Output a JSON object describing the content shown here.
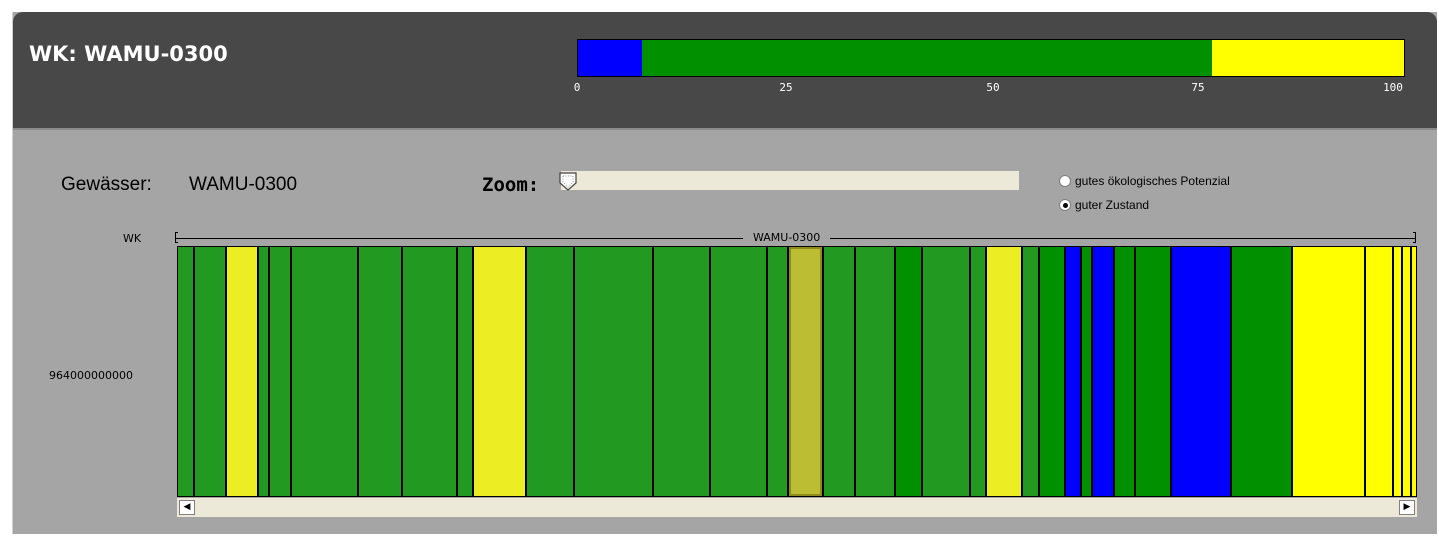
{
  "header": {
    "title": "WK: WAMU-0300",
    "summary": {
      "scale_ticks": [
        "0",
        "25",
        "50",
        "75",
        "100"
      ],
      "segments": [
        {
          "from": 0,
          "to": 7.8,
          "color": "#0000ff"
        },
        {
          "from": 7.8,
          "to": 76.8,
          "color": "#009000"
        },
        {
          "from": 76.8,
          "to": 100,
          "color": "#ffff00"
        }
      ]
    }
  },
  "info": {
    "gewaesser_label": "Gewässer:",
    "gewaesser_value": "WAMU-0300",
    "zoom_label": "Zoom:",
    "zoom_level": 0
  },
  "options": {
    "radio_potential": "gutes ökologisches Potenzial",
    "radio_zustand": "guter Zustand",
    "selected": "guter Zustand"
  },
  "track": {
    "wk_label": "WK",
    "wk_name": "WAMU-0300",
    "section_label": "964000000000"
  },
  "strip_segments": [
    {
      "color": "#229a22",
      "share": 1.32
    },
    {
      "color": "#229a22",
      "share": 2.57
    },
    {
      "color": "#eded24",
      "share": 2.57
    },
    {
      "color": "#229a22",
      "share": 0.88
    },
    {
      "color": "#229a22",
      "share": 1.69
    },
    {
      "color": "#229a22",
      "share": 5.31
    },
    {
      "color": "#229a22",
      "share": 3.54
    },
    {
      "color": "#229a22",
      "share": 4.35
    },
    {
      "color": "#229a22",
      "share": 1.29
    },
    {
      "color": "#eded24",
      "share": 4.19
    },
    {
      "color": "#229a22",
      "share": 3.8
    },
    {
      "color": "#229a22",
      "share": 6.28
    },
    {
      "color": "#229a22",
      "share": 4.51
    },
    {
      "color": "#229a22",
      "share": 4.51
    },
    {
      "color": "#229a22",
      "share": 1.69
    },
    {
      "color": "#bdbd33",
      "share": 2.74,
      "selected": true
    },
    {
      "color": "#229a22",
      "share": 2.57
    },
    {
      "color": "#229a22",
      "share": 3.22
    },
    {
      "color": "#009000",
      "share": 2.09
    },
    {
      "color": "#229a22",
      "share": 3.8
    },
    {
      "color": "#229a22",
      "share": 1.29
    },
    {
      "color": "#eded24",
      "share": 2.9
    },
    {
      "color": "#229a22",
      "share": 1.29
    },
    {
      "color": "#009000",
      "share": 2.09
    },
    {
      "color": "#0000ff",
      "share": 1.29
    },
    {
      "color": "#009000",
      "share": 0.88
    },
    {
      "color": "#0000ff",
      "share": 1.69
    },
    {
      "color": "#009000",
      "share": 1.69
    },
    {
      "color": "#009000",
      "share": 2.9
    },
    {
      "color": "#0000ff",
      "share": 4.75
    },
    {
      "color": "#009000",
      "share": 4.83
    },
    {
      "color": "#ffff00",
      "share": 5.8
    },
    {
      "color": "#ffff00",
      "share": 2.17
    },
    {
      "color": "#ffff00",
      "share": 0.73
    },
    {
      "color": "#ffff00",
      "share": 0.73
    },
    {
      "color": "#ffff00",
      "share": 0.48
    }
  ]
}
